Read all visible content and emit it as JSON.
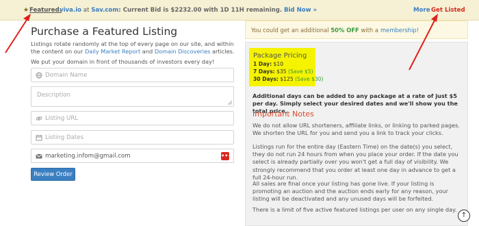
{
  "topbar": {
    "featured_label": "Featured:",
    "listing_domain": "viva.io",
    "listing_at": " at ",
    "listing_site": "Sav.com",
    "current_bid": ": Current Bid is $2232.00 with 1D 11H remaining.",
    "bid_now": "Bid Now »",
    "more": "More",
    "get_listed": "Get Listed"
  },
  "main": {
    "title": "Purchase a Featured Listing",
    "intro_prefix": "Listings rotate randomly at the top of every page on our site, and within the content on our",
    "intro_link1": "Daily Market Report",
    "intro_and": "and",
    "intro_link2": "Domain Discoveries",
    "intro_suffix": "articles.",
    "promo": "We put your domain in front of thousands of investors every day!"
  },
  "form": {
    "domain_placeholder": "Domain Name",
    "description_placeholder": "Description",
    "url_placeholder": "Listing URL",
    "dates_placeholder": "Listing Dates",
    "email_value": "marketing.infom@gmail.com",
    "submit_label": "Review Order"
  },
  "membership_alert": {
    "prefix": "You could get an additional",
    "discount": "50% OFF",
    "middle": "with a",
    "link": "membership!"
  },
  "pricing": {
    "title": "Package Pricing",
    "rows": [
      {
        "days": "1 Day:",
        "price": "$10",
        "save": ""
      },
      {
        "days": "7 Days:",
        "price": "$35",
        "save": "(Save $5)"
      },
      {
        "days": "30 Days:",
        "price": "$125",
        "save": "(Save $30)"
      }
    ]
  },
  "info": {
    "extra_days": "Additional days can be added to any package at a rate of just $5 per day. Simply select your desired dates and we'll show you the total price.",
    "notes_title": "Important Notes",
    "paragraphs": [
      "We do not allow URL shorteners, affiliate links, or linking to parked pages. We shorten the URL for you and send you a link to track your clicks.",
      "Listings run for the entire day (Eastern Time) on the date(s) you select, they do not run 24 hours from when you place your order. If the date you select is already partially over you won't get a full day of visibility. We strongly recommend that you order at least one day in advance to get a full 24-hour run.",
      "All sales are final once your listing has gone live. If your listing is promoting an auction and the auction ends early for any reason, your listing will be deactivated and any unused days will be forfeited.",
      "There is a limit of five active featured listings per user on any single day."
    ]
  },
  "colors": {
    "accent_blue": "#3a7fc1",
    "alert_red": "#d9281e",
    "highlight_yellow": "#f5f300",
    "save_green": "#3c9a3c"
  }
}
